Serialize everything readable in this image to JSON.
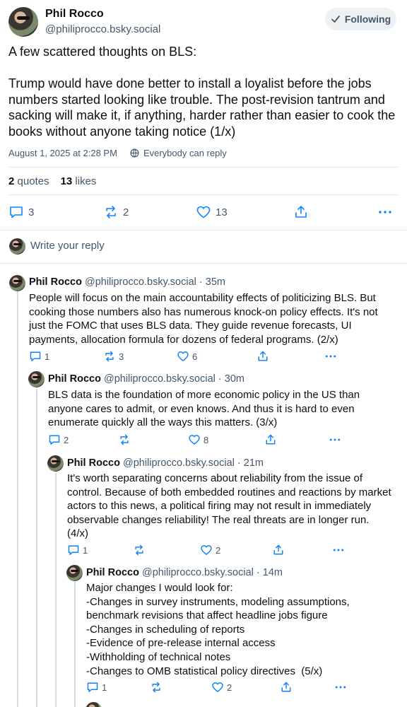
{
  "post": {
    "author_name": "Phil Rocco",
    "author_handle": "@philiprocco.bsky.social",
    "follow_label": "Following",
    "text": "A few scattered thoughts on BLS:\n\nTrump would have done better to install a loyalist before the jobs numbers started looking like trouble. The post-revision tantrum and sacking will make it, if anything, harder rather than easier to cook the books without anyone taking notice (1/x)",
    "timestamp": "August 1, 2025 at 2:28 PM",
    "visibility": "Everybody can reply",
    "quotes_count": "2",
    "quotes_label": "quotes",
    "likes_count": "13",
    "likes_label": "likes",
    "actions": {
      "replies": "3",
      "reposts": "2",
      "likes": "13"
    }
  },
  "reply_prompt": "Write your reply",
  "replies": [
    {
      "name": "Phil Rocco",
      "handle": "@philiprocco.bsky.social · 35m",
      "text": "People will focus on the main accountability effects of politicizing BLS. But cooking those numbers also has numerous knock-on policy effects. It's not just the FOMC that uses BLS data. They guide revenue forecasts, UI payments, allocation formula for dozens of federal programs. (2/x)",
      "replies": "1",
      "reposts": "3",
      "likes": "6"
    },
    {
      "name": "Phil Rocco",
      "handle": "@philiprocco.bsky.social · 30m",
      "text": "BLS data is the foundation of more economic policy in the US than anyone cares to admit, or even knows. And thus it is hard to even enumerate quickly all the ways this matters. (3/x)",
      "replies": "2",
      "reposts": "",
      "likes": "8"
    },
    {
      "name": "Phil Rocco",
      "handle": "@philiprocco.bsky.social · 21m",
      "text": "It's worth separating concerns about reliability from the issue of control. Because of both embedded routines and reactions by market actors to this news, a political firing may not result in immediately observable changes reliability! The real threats are in longer run. (4/x)",
      "replies": "1",
      "reposts": "",
      "likes": "2"
    },
    {
      "name": "Phil Rocco",
      "handle": "@philiprocco.bsky.social · 14m",
      "text": "Major changes I would look for:\n-Changes in survey instruments, modeling assumptions, benchmark revisions that affect headline jobs figure\n-Changes in scheduling of reports\n-Evidence of pre-release internal access\n-Withholding of technical notes\n-Changes to OMB statistical policy directives  (5/x)",
      "replies": "1",
      "reposts": "",
      "likes": "2"
    }
  ],
  "colors": {
    "text": "#0b0f14",
    "muted": "#42576c",
    "divider": "#e3e8ec",
    "follow_bg": "#eef1f4"
  },
  "icons": [
    "check-icon",
    "globe-icon",
    "reply-icon",
    "repost-icon",
    "like-icon",
    "share-icon",
    "more-icon"
  ]
}
